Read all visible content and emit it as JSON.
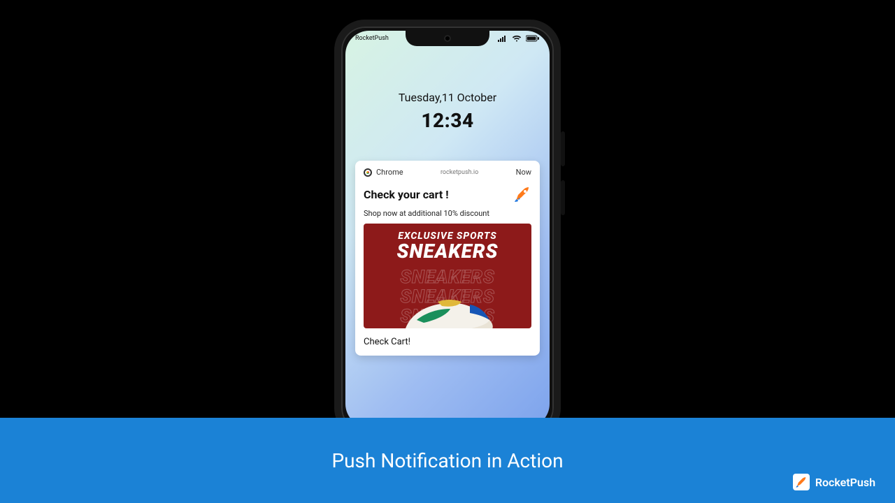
{
  "status": {
    "carrier": "RocketPush"
  },
  "lock": {
    "date": "Tuesday,11 October",
    "time": "12:34"
  },
  "notification": {
    "app": "Chrome",
    "source": "rocketpush.io",
    "when": "Now",
    "title": "Check your cart !",
    "subtitle": "Shop now at additional 10% discount",
    "cta": "Check Cart!",
    "promo": {
      "line1": "EXCLUSIVE SPORTS",
      "line2": "SNEAKERS",
      "ghost": "SNEAKERS"
    }
  },
  "footer": {
    "title": "Push Notification in Action",
    "brand": "RocketPush"
  }
}
